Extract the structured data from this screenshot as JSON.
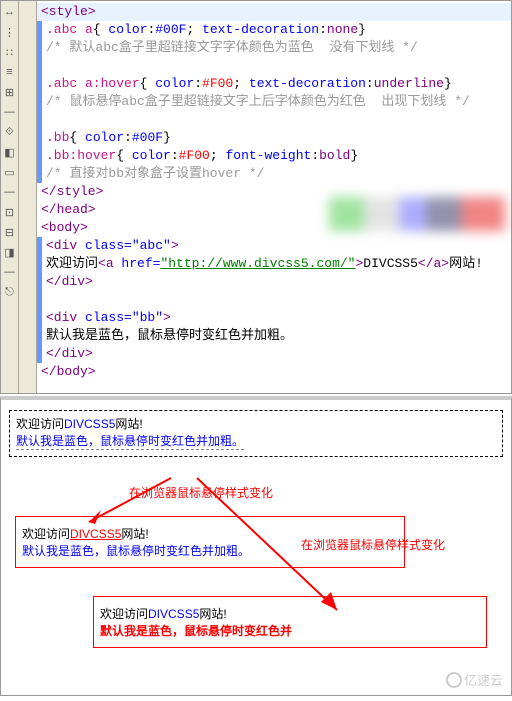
{
  "gutter_icons": [
    "↔",
    "⋮",
    "∷",
    "≡",
    "⊞",
    "—",
    "⟐",
    "◧",
    "▭",
    "—",
    "⊡",
    "⊟",
    "◨",
    "—",
    "⎋"
  ],
  "code": {
    "l1": {
      "tag_open": "<style>",
      "tag_close": ">"
    },
    "l2": {
      "sel": ".abc a",
      "brace": "{ ",
      "p1": "color",
      "c1": ":",
      "v1": "#00F",
      "s1": "; ",
      "p2": "text-decoration",
      "c2": ":",
      "v2": "none",
      "end": "}"
    },
    "l3": {
      "cm": "/* 默认abc盒子里超链接文字字体颜色为蓝色  没有下划线 */"
    },
    "l4": {
      "blank": " "
    },
    "l5": {
      "sel": ".abc a:hover",
      "brace": "{ ",
      "p1": "color",
      "c1": ":",
      "v1": "#F00",
      "s1": "; ",
      "p2": "text-decoration",
      "c2": ":",
      "v2": "underline",
      "end": "}"
    },
    "l6": {
      "cm": "/* 鼠标悬停abc盒子里超链接文字上后字体颜色为红色  出现下划线 */"
    },
    "l7": {
      "blank": " "
    },
    "l8": {
      "sel": ".bb",
      "brace": "{ ",
      "p1": "color",
      "c1": ":",
      "v1": "#00F",
      "end": "}"
    },
    "l9": {
      "sel": ".bb:hover",
      "brace": "{ ",
      "p1": "color",
      "c1": ":",
      "v1": "#F00",
      "s1": "; ",
      "p2": "font-weight",
      "c2": ":",
      "v2": "bold",
      "end": "}"
    },
    "l10": {
      "cm": "/* 直接对bb对象盒子设置hover */"
    },
    "l11": {
      "tag": "</style>"
    },
    "l12": {
      "tag": "</head>"
    },
    "l13": {
      "tag": "<body>"
    },
    "l14": {
      "open": "<div ",
      "attr": "class=",
      "val": "\"abc\"",
      "close": ">"
    },
    "l15": {
      "t1": "欢迎访问",
      "aopen": "<a ",
      "href": "href=",
      "url": "\"http://www.divcss5.com/\"",
      "gt": ">",
      "linktext": "DIVCSS5",
      "aclose": "</a>",
      "t2": "网站!"
    },
    "l16": {
      "tag": "</div>"
    },
    "l17": {
      "blank": " "
    },
    "l18": {
      "open": "<div ",
      "attr": "class=",
      "val": "\"bb\"",
      "close": ">"
    },
    "l19": {
      "txt": "默认我是蓝色，鼠标悬停时变红色并加粗。"
    },
    "l20": {
      "tag": "</div>"
    },
    "l21": {
      "tag": "</body>"
    }
  },
  "preview": {
    "welcome": "欢迎访问",
    "link": "DIVCSS5",
    "site": "网站!",
    "line2": "默认我是蓝色，鼠标悬停时变红色并加粗。",
    "line2_cut": "默认我是蓝色，鼠标悬停时变红色并",
    "note": "在浏览器鼠标悬停样式变化"
  },
  "watermark": "亿速云"
}
